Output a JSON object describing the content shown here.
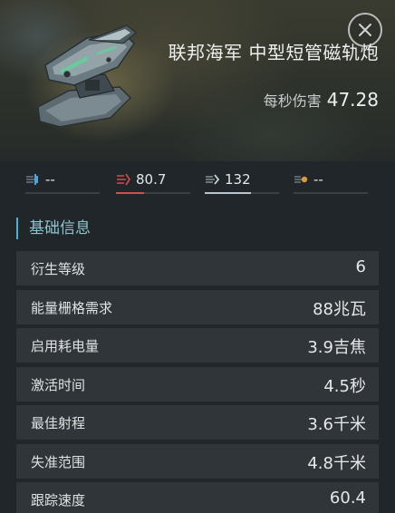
{
  "header": {
    "title": "联邦海军 中型短管磁轨炮",
    "dps_label": "每秒伤害",
    "dps_value": "47.28",
    "close_icon": "close-icon",
    "module_image": "railgun-module-image"
  },
  "damage": [
    {
      "type": "em",
      "icon": "em-damage-icon",
      "value": "--",
      "color": "#4da3d8"
    },
    {
      "type": "thermal",
      "icon": "thermal-damage-icon",
      "value": "80.7",
      "color": "#d64b4b",
      "fill": 0.38
    },
    {
      "type": "kinetic",
      "icon": "kinetic-damage-icon",
      "value": "132",
      "color": "#b8c4cc",
      "fill": 0.62
    },
    {
      "type": "explosive",
      "icon": "explosive-damage-icon",
      "value": "--",
      "color": "#d99a3b"
    }
  ],
  "section": {
    "title": "基础信息"
  },
  "attributes": [
    {
      "label": "衍生等级",
      "value": "6"
    },
    {
      "label": "能量栅格需求",
      "value": "88兆瓦"
    },
    {
      "label": "启用耗电量",
      "value": "3.9吉焦"
    },
    {
      "label": "激活时间",
      "value": "4.5秒"
    },
    {
      "label": "最佳射程",
      "value": "3.6千米"
    },
    {
      "label": "失准范围",
      "value": "4.8千米"
    },
    {
      "label": "跟踪速度",
      "value": "60.4"
    }
  ]
}
